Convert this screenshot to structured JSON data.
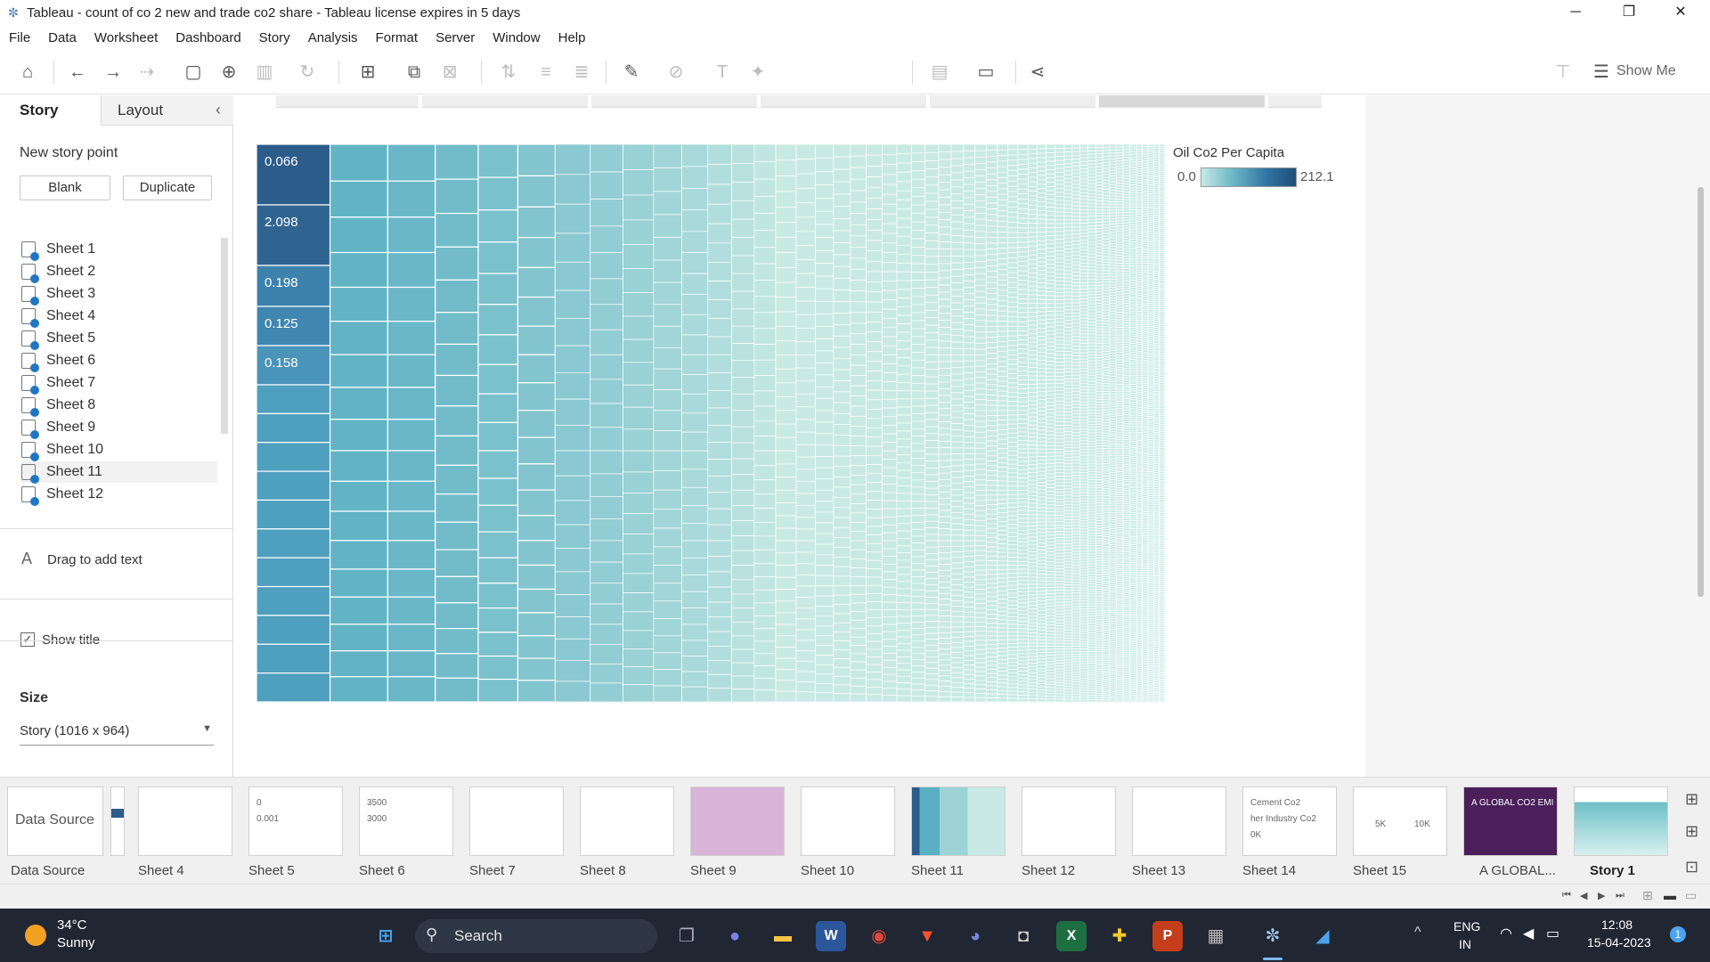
{
  "window": {
    "title": "Tableau - count of co 2 new and trade co2 share - Tableau license expires in 5 days",
    "minimize": "─",
    "restore": "❐",
    "close": "✕"
  },
  "menu": [
    "File",
    "Data",
    "Worksheet",
    "Dashboard",
    "Story",
    "Analysis",
    "Format",
    "Server",
    "Window",
    "Help"
  ],
  "toolbar": {
    "show_me_label": "Show Me"
  },
  "left_pane": {
    "tab_story": "Story",
    "tab_layout": "Layout",
    "collapse_icon": "‹",
    "new_story_point": "New story point",
    "blank_button": "Blank",
    "duplicate_button": "Duplicate",
    "sheets": [
      "Sheet 1",
      "Sheet 2",
      "Sheet 3",
      "Sheet 4",
      "Sheet 5",
      "Sheet 6",
      "Sheet 7",
      "Sheet 8",
      "Sheet 9",
      "Sheet 10",
      "Sheet 11",
      "Sheet 12"
    ],
    "drag_text_icon": "A",
    "drag_text": "Drag to add text",
    "show_title": "Show title",
    "size_label": "Size",
    "size_value": "Story (1016 x 964)"
  },
  "treemap": {
    "labels": [
      "0.066",
      "2.098",
      "0.198",
      "0.125",
      "0.158"
    ],
    "colors": {
      "dark": "#2b5c8a",
      "mid": "#5ab0c2",
      "light": "#c9eae4"
    }
  },
  "legend": {
    "title": "Oil Co2 Per Capita",
    "min": "0.0",
    "max": "212.1"
  },
  "filmstrip": {
    "data_source_label": "Data Source",
    "tabs": [
      {
        "label": "Data Source"
      },
      {
        "label": "Sheet 4"
      },
      {
        "label": "Sheet 5",
        "thumb_text": [
          "0",
          "0.001"
        ]
      },
      {
        "label": "Sheet 6",
        "thumb_text": [
          "3500",
          "3000"
        ]
      },
      {
        "label": "Sheet 7"
      },
      {
        "label": "Sheet 8"
      },
      {
        "label": "Sheet 9"
      },
      {
        "label": "Sheet 10"
      },
      {
        "label": "Sheet 11"
      },
      {
        "label": "Sheet 12"
      },
      {
        "label": "Sheet 13"
      },
      {
        "label": "Sheet 14",
        "thumb_text": [
          "Cement Co2",
          "her Industry Co2",
          "0K"
        ]
      },
      {
        "label": "Sheet 15",
        "thumb_text": [
          "5K",
          "10K"
        ]
      },
      {
        "label": "A GLOBAL...",
        "thumb_text": [
          "A GLOBAL CO2 EMI"
        ]
      },
      {
        "label": "Story 1"
      }
    ]
  },
  "taskbar": {
    "temperature": "34°C",
    "weather": "Sunny",
    "search": "Search",
    "language_1": "ENG",
    "language_2": "IN",
    "time": "12:08",
    "date": "15-04-2023",
    "notification_count": "1"
  }
}
